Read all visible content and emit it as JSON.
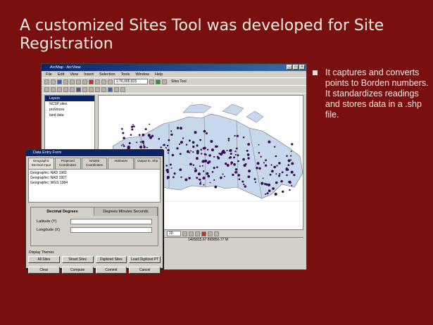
{
  "slide": {
    "title": "A customized Sites Tool was developed for Site Registration",
    "bullet": "It captures and converts points to Borden numbers. It standardizes readings and stores data in a .shp file."
  },
  "app": {
    "window_title": "ArcMap - ArcView",
    "menu": [
      "File",
      "Edit",
      "View",
      "Insert",
      "Selection",
      "Tools",
      "Window",
      "Help"
    ],
    "scale": "1:76,005,815",
    "sites_tool_label": "Sites Tool",
    "toc": [
      "Layers",
      "NCSP sites",
      "provinces",
      "land data"
    ],
    "coords": "1405815.67 865856.77 M",
    "font_size": "10"
  },
  "dialog": {
    "title": "Data Entry Form",
    "tabs": [
      "Geographic Decimal Input",
      "Projected Coordinates",
      "NAD83 Coordinates",
      "Attributes",
      "Output to .Shp"
    ],
    "list_items": [
      "Geographic: NAD 1983",
      "Geographic: NAD 1927",
      "Geographic: WGS 1984"
    ],
    "format_tabs": [
      "Decimal Degrees",
      "Degrees Minutes Seconds"
    ],
    "latitude_label": "Latitude (Y)",
    "longitude_label": "Longitude (X)",
    "display_label": "Display Themes",
    "buttons_row1": [
      "All Sites",
      "Street Sites",
      "Digitized Sites",
      "Load Digitized PT"
    ],
    "buttons_row2": [
      "Clear",
      "Compute",
      "Commit",
      "Cancel"
    ]
  },
  "colors": {
    "slide_bg": "#7a0f10",
    "text": "#f4ede0",
    "map_land": "#c8d8ec",
    "site_points": "#3a0a5a"
  }
}
